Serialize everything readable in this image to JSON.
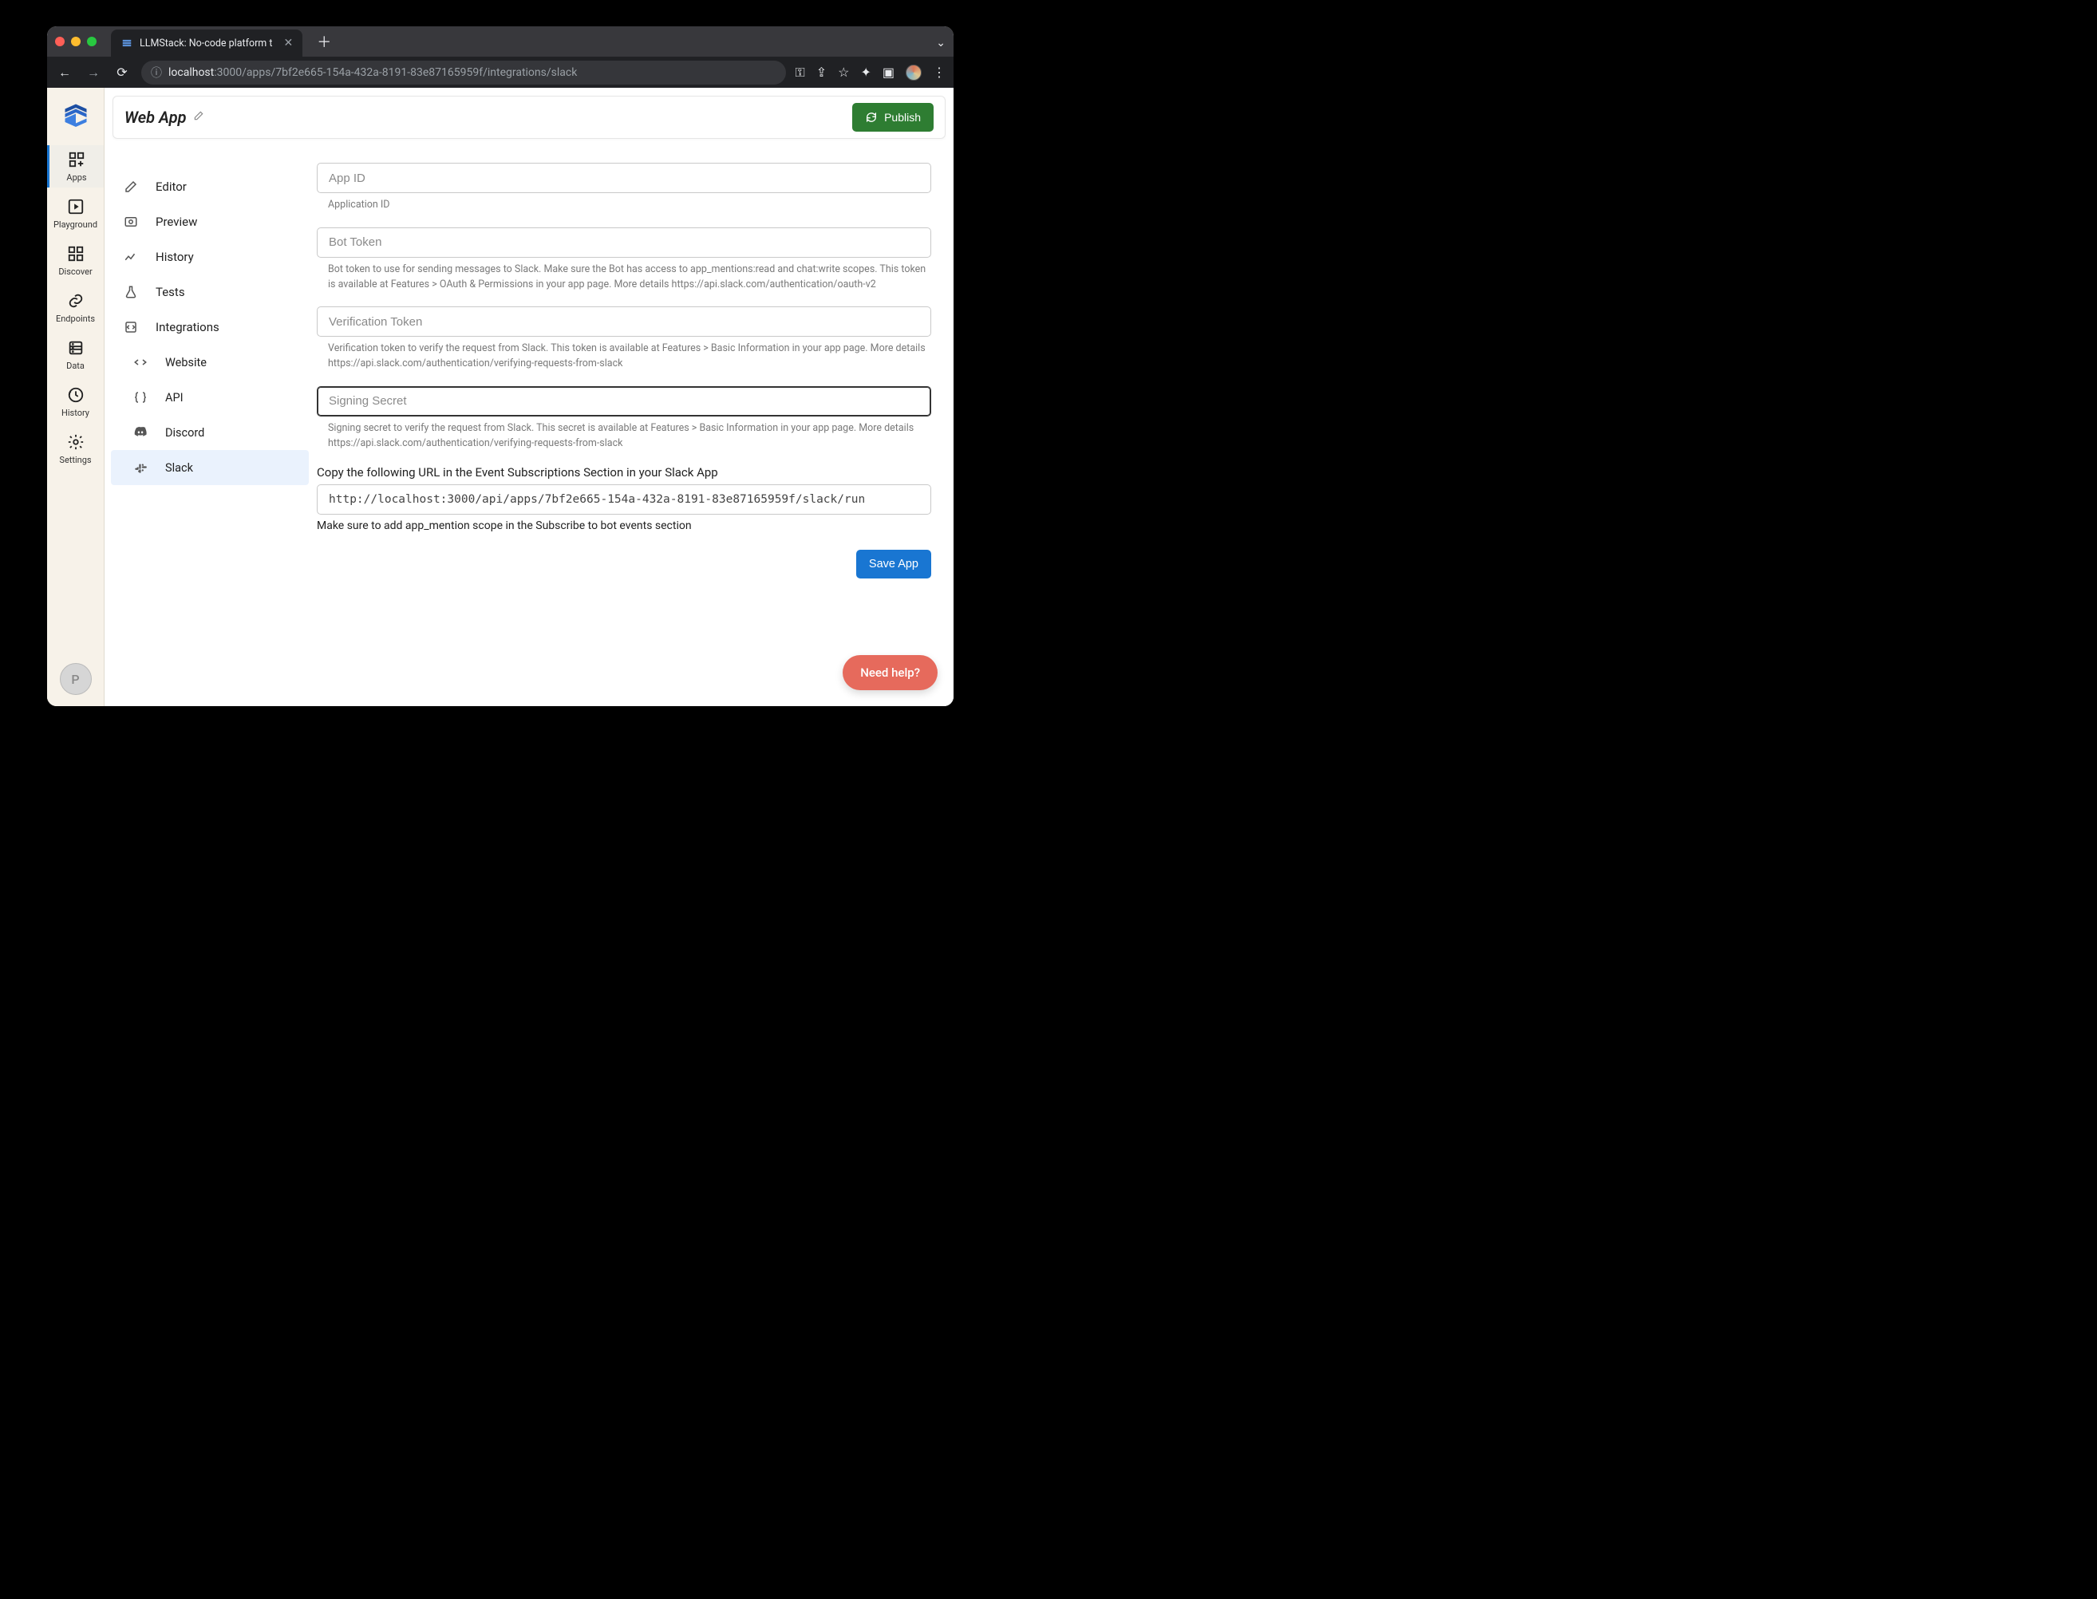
{
  "browser": {
    "tab_title": "LLMStack: No-code platform t",
    "url_host": "localhost",
    "url_path": ":3000/apps/7bf2e665-154a-432a-8191-83e87165959f/integrations/slack"
  },
  "rail": {
    "items": [
      {
        "key": "apps",
        "label": "Apps"
      },
      {
        "key": "playground",
        "label": "Playground"
      },
      {
        "key": "discover",
        "label": "Discover"
      },
      {
        "key": "endpoints",
        "label": "Endpoints"
      },
      {
        "key": "data",
        "label": "Data"
      },
      {
        "key": "history",
        "label": "History"
      },
      {
        "key": "settings",
        "label": "Settings"
      }
    ],
    "profile_initial": "P"
  },
  "header": {
    "title": "Web App",
    "publish_label": "Publish"
  },
  "editor_nav": [
    {
      "key": "editor",
      "label": "Editor"
    },
    {
      "key": "preview",
      "label": "Preview"
    },
    {
      "key": "history",
      "label": "History"
    },
    {
      "key": "tests",
      "label": "Tests"
    },
    {
      "key": "integrations",
      "label": "Integrations"
    },
    {
      "key": "website",
      "label": "Website",
      "sub": true
    },
    {
      "key": "api",
      "label": "API",
      "sub": true
    },
    {
      "key": "discord",
      "label": "Discord",
      "sub": true
    },
    {
      "key": "slack",
      "label": "Slack",
      "sub": true,
      "selected": true
    }
  ],
  "form": {
    "fields": {
      "app_id": {
        "placeholder": "App ID",
        "helper": "Application ID"
      },
      "bot_token": {
        "placeholder": "Bot Token",
        "helper": "Bot token to use for sending messages to Slack. Make sure the Bot has access to app_mentions:read and chat:write scopes. This token is available at Features > OAuth & Permissions in your app page. More details https://api.slack.com/authentication/oauth-v2"
      },
      "verification_token": {
        "placeholder": "Verification Token",
        "helper": "Verification token to verify the request from Slack. This token is available at Features > Basic Information in your app page. More details https://api.slack.com/authentication/verifying-requests-from-slack"
      },
      "signing_secret": {
        "placeholder": "Signing Secret",
        "helper": "Signing secret to verify the request from Slack. This secret is available at Features > Basic Information in your app page. More details https://api.slack.com/authentication/verifying-requests-from-slack"
      }
    },
    "event_url_label": "Copy the following URL in the Event Subscriptions Section in your Slack App",
    "event_url": "http://localhost:3000/api/apps/7bf2e665-154a-432a-8191-83e87165959f/slack/run",
    "scope_note": "Make sure to add app_mention scope in the Subscribe to bot events section",
    "save_label": "Save App"
  },
  "help_label": "Need help?"
}
